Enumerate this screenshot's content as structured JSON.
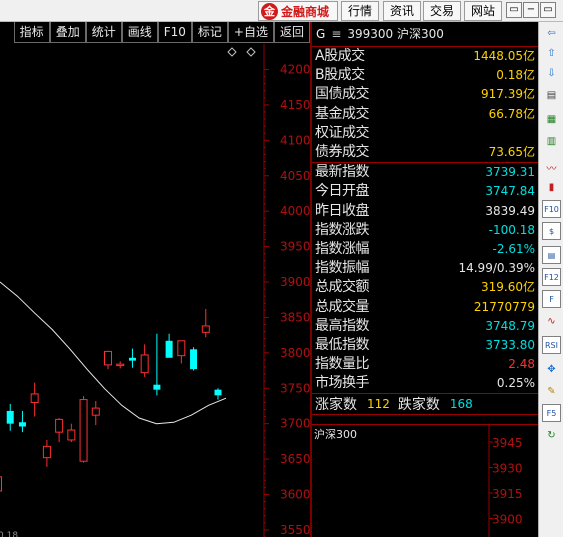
{
  "topbar": {
    "brand_logo": "金",
    "brand_text": "金融商城",
    "buttons": [
      "行情",
      "资讯",
      "交易",
      "网站"
    ],
    "window_buttons": [
      "▭",
      "−",
      "▭",
      "✕"
    ]
  },
  "toolbar": {
    "buttons": [
      "指标",
      "叠加",
      "统计",
      "画线",
      "F10",
      "标记",
      "+自选",
      "返回"
    ]
  },
  "chart_data": {
    "type": "candlestick",
    "y_ticks": [
      4200,
      4150,
      4100,
      4050,
      4000,
      3950,
      3900,
      3850,
      3800,
      3750,
      3700,
      3650,
      3600,
      3550
    ],
    "ylim": [
      3540,
      4236
    ],
    "x_tick_partial": "0.18",
    "candles": [
      {
        "o": 3605,
        "h": 3632,
        "l": 3600,
        "c": 3625
      },
      {
        "o": 3718,
        "h": 3728,
        "l": 3690,
        "c": 3700
      },
      {
        "o": 3702,
        "h": 3718,
        "l": 3688,
        "c": 3696
      },
      {
        "o": 3730,
        "h": 3758,
        "l": 3710,
        "c": 3742
      },
      {
        "o": 3652,
        "h": 3677,
        "l": 3639,
        "c": 3668
      },
      {
        "o": 3688,
        "h": 3708,
        "l": 3674,
        "c": 3706
      },
      {
        "o": 3677,
        "h": 3700,
        "l": 3674,
        "c": 3691
      },
      {
        "o": 3647,
        "h": 3739,
        "l": 3645,
        "c": 3734
      },
      {
        "o": 3712,
        "h": 3732,
        "l": 3698,
        "c": 3722
      },
      {
        "o": 3783,
        "h": 3803,
        "l": 3777,
        "c": 3802
      },
      {
        "o": 3782,
        "h": 3788,
        "l": 3778,
        "c": 3784
      },
      {
        "o": 3793,
        "h": 3806,
        "l": 3779,
        "c": 3789
      },
      {
        "o": 3772,
        "h": 3812,
        "l": 3766,
        "c": 3797
      },
      {
        "o": 3755,
        "h": 3827,
        "l": 3740,
        "c": 3748
      },
      {
        "o": 3817,
        "h": 3827,
        "l": 3794,
        "c": 3793
      },
      {
        "o": 3796,
        "h": 3806,
        "l": 3785,
        "c": 3817
      },
      {
        "o": 3805,
        "h": 3808,
        "l": 3775,
        "c": 3777
      },
      {
        "o": 3829,
        "h": 3862,
        "l": 3822,
        "c": 3838
      },
      {
        "o": 3748,
        "h": 3750,
        "l": 3734,
        "c": 3740
      }
    ],
    "ma_line": [
      3900,
      3880,
      3856,
      3833,
      3806,
      3777,
      3750,
      3726,
      3708,
      3700,
      3702,
      3712,
      3726,
      3736
    ]
  },
  "info": {
    "code_prefix": "G",
    "menu_icon": "≡",
    "code": "399300",
    "name": "沪深300",
    "section1": [
      {
        "label": "A股成交",
        "value": "1448.05亿",
        "color": "#ffd200"
      },
      {
        "label": "B股成交",
        "value": "0.18亿",
        "color": "#ffd200"
      },
      {
        "label": "国债成交",
        "value": "917.39亿",
        "color": "#ffd200"
      },
      {
        "label": "基金成交",
        "value": "66.78亿",
        "color": "#ffd200"
      },
      {
        "label": "权证成交",
        "value": "",
        "color": "#ffd200"
      },
      {
        "label": "债券成交",
        "value": "73.65亿",
        "color": "#ffd200"
      }
    ],
    "section2": [
      {
        "label": "最新指数",
        "value": "3739.31",
        "color": "#00e0e0"
      },
      {
        "label": "今日开盘",
        "value": "3747.84",
        "color": "#00e0e0"
      },
      {
        "label": "昨日收盘",
        "value": "3839.49",
        "color": "#e6e6e6"
      },
      {
        "label": "指数涨跌",
        "value": "-100.18",
        "color": "#00e0e0"
      },
      {
        "label": "指数涨幅",
        "value": "-2.61%",
        "color": "#00e0e0"
      },
      {
        "label": "指数振幅",
        "value": "14.99/0.39%",
        "color": "#e6e6e6"
      },
      {
        "label": "总成交额",
        "value": "319.60亿",
        "color": "#ffd200"
      },
      {
        "label": "总成交量",
        "value": "21770779",
        "color": "#ffd200"
      },
      {
        "label": "最高指数",
        "value": "3748.79",
        "color": "#00e0e0"
      },
      {
        "label": "最低指数",
        "value": "3733.80",
        "color": "#00e0e0"
      },
      {
        "label": "指数量比",
        "value": "2.48",
        "color": "#ff3030"
      },
      {
        "label": "市场换手",
        "value": "0.25%",
        "color": "#e6e6e6"
      }
    ],
    "updown": {
      "up_label": "涨家数",
      "up_value": "112",
      "down_label": "跌家数",
      "down_value": "168"
    },
    "mini_chart": {
      "title": "沪深300",
      "y_ticks": [
        "3945",
        "3930",
        "3915",
        "3900"
      ]
    }
  },
  "sidebar": {
    "icons": [
      "arrow-left-icon",
      "arrow-up-icon",
      "arrow-down-icon",
      "list-icon",
      "table-icon",
      "grid-icon",
      "line-chart-icon",
      "candle-chart-icon",
      "f10-icon",
      "dollar-icon",
      "report-icon",
      "f12-icon",
      "text-f-icon",
      "wave-icon",
      "rsi-icon",
      "move-icon",
      "pencil-icon",
      "f5-icon",
      "refresh-icon"
    ],
    "labels": [
      "⇦",
      "⇧",
      "⇩",
      "▤",
      "▦",
      "▥",
      "〰",
      "▮",
      "F10",
      "$",
      "▤",
      "F12",
      "F",
      "∿",
      "RSI",
      "✥",
      "✎",
      "F5",
      "↻"
    ]
  }
}
